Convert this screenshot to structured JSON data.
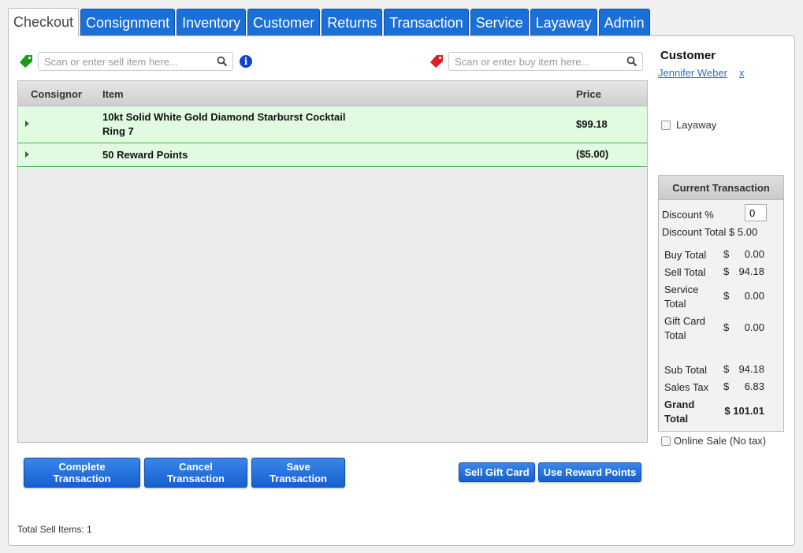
{
  "tabs": [
    {
      "label": "Checkout",
      "active": true
    },
    {
      "label": "Consignment"
    },
    {
      "label": "Inventory"
    },
    {
      "label": "Customer"
    },
    {
      "label": "Returns"
    },
    {
      "label": "Transaction"
    },
    {
      "label": "Service"
    },
    {
      "label": "Layaway"
    },
    {
      "label": "Admin"
    }
  ],
  "search": {
    "sell_placeholder": "Scan or enter sell item here...",
    "buy_placeholder": "Scan or enter buy item here...",
    "sell_value": "",
    "buy_value": "",
    "sell_tag_color": "#1a9a1a",
    "buy_tag_color": "#e02020",
    "info_glyph": "i"
  },
  "grid": {
    "headers": {
      "consignor": "Consignor",
      "item": "Item",
      "price": "Price"
    },
    "rows": [
      {
        "consignor": "",
        "item": "10kt Solid White Gold Diamond Starburst Cocktail Ring 7",
        "price": "$99.18"
      },
      {
        "consignor": "",
        "item": "50 Reward Points",
        "price": "($5.00)"
      }
    ]
  },
  "customer": {
    "title": "Customer",
    "name": "Jennifer Weber",
    "remove": "x"
  },
  "layaway": {
    "label": "Layaway",
    "checked": false
  },
  "current_transaction": {
    "title": "Current Transaction",
    "discount_label": "Discount %",
    "discount_value": "0",
    "discount_total": "Discount Total $ 5.00",
    "currency": "$",
    "lines": {
      "buy": {
        "label": "Buy Total",
        "amount": "0.00"
      },
      "sell": {
        "label": "Sell Total",
        "amount": "94.18"
      },
      "service": {
        "label": "Service Total",
        "amount": "0.00"
      },
      "giftcard": {
        "label": "Gift Card Total",
        "amount": "0.00"
      },
      "subtotal": {
        "label": "Sub Total",
        "amount": "94.18"
      },
      "tax": {
        "label": "Sales Tax",
        "amount": "6.83"
      },
      "grand": {
        "label": "Grand Total",
        "amount": "$ 101.01"
      }
    }
  },
  "online_sale": {
    "label": "Online Sale (No tax)",
    "checked": false
  },
  "buttons": {
    "complete": "Complete Transaction",
    "cancel": "Cancel Transaction",
    "save": "Save Transaction",
    "sell_gift_card": "Sell Gift Card",
    "use_reward_points": "Use Reward Points"
  },
  "footer": {
    "total_sell_items": "Total Sell Items: 1"
  },
  "colors": {
    "accent": "#1a6fd8",
    "row_bg": "#e0fbe0",
    "row_border": "#4ab04a",
    "link": "#2d6dd6"
  }
}
